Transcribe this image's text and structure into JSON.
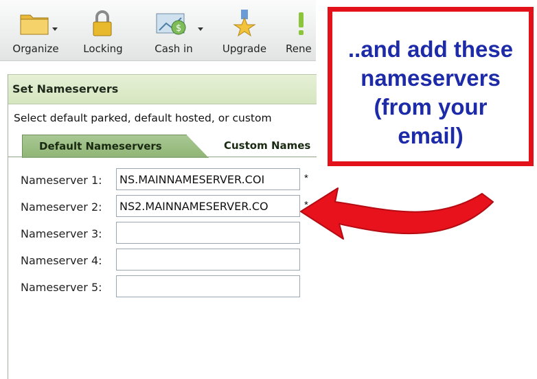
{
  "toolbar": {
    "organize_label": "Organize",
    "locking_label": "Locking",
    "cashin_label": "Cash in",
    "upgrade_label": "Upgrade",
    "renew_label": "Rene"
  },
  "panel": {
    "title": "Set Nameservers",
    "description": "Select default parked, default hosted, or custom",
    "tabs": [
      {
        "label": "Default Nameservers"
      },
      {
        "label": "Custom Names"
      }
    ],
    "nameservers": [
      {
        "label": "Nameserver 1:",
        "value": "NS.MAINNAMESERVER.COI",
        "required": "*"
      },
      {
        "label": "Nameserver 2:",
        "value": "NS2.MAINNAMESERVER.CO",
        "required": "*"
      },
      {
        "label": "Nameserver 3:",
        "value": ""
      },
      {
        "label": "Nameserver 4:",
        "value": ""
      },
      {
        "label": "Nameserver 5:",
        "value": ""
      }
    ]
  },
  "callout": {
    "line1": "..and add these",
    "line2": "nameservers",
    "line3": "(from your",
    "line4": "email)"
  },
  "colors": {
    "callout_border": "#e3121a",
    "callout_text": "#1e2ba8",
    "tab_active": "#9cbf83",
    "header_bg": "#dde9c9"
  },
  "icons": [
    "folder-icon",
    "lock-icon",
    "cash-icon",
    "upgrade-star-icon",
    "renew-icon",
    "red-arrow-icon"
  ]
}
